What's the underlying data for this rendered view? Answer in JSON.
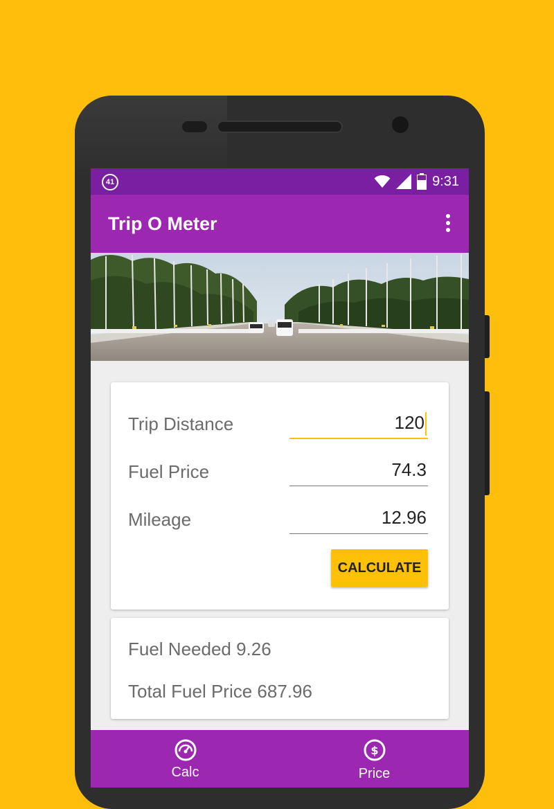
{
  "status_bar": {
    "notification_badge": "41",
    "time": "9:31",
    "icons": [
      "wifi-icon",
      "signal-icon",
      "battery-icon"
    ]
  },
  "app_bar": {
    "title": "Trip O Meter",
    "overflow_icon": "more-vertical-icon"
  },
  "form": {
    "trip_distance": {
      "label": "Trip Distance",
      "value": "120"
    },
    "fuel_price": {
      "label": "Fuel Price",
      "value": "74.3"
    },
    "mileage": {
      "label": "Mileage",
      "value": "12.96"
    },
    "calculate_label": "CALCULATE"
  },
  "results": {
    "fuel_needed": "Fuel Needed 9.26",
    "total_fuel_price": "Total Fuel Price 687.96"
  },
  "bottom_nav": {
    "items": [
      {
        "label": "Calc",
        "icon": "speedometer-icon"
      },
      {
        "label": "Price",
        "icon": "dollar-icon"
      }
    ]
  },
  "colors": {
    "background": "#FFBE0B",
    "primary": "#9C27B0",
    "primary_dark": "#7B1FA2",
    "accent": "#FFC107"
  }
}
